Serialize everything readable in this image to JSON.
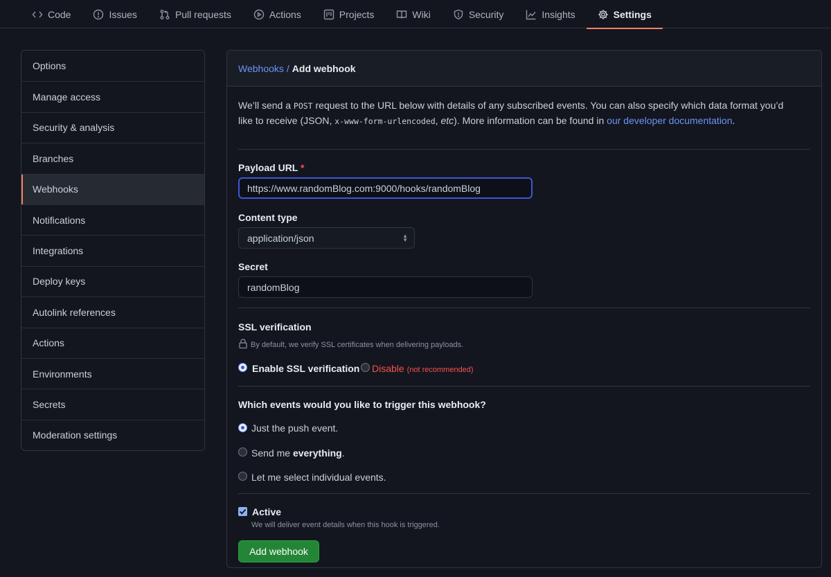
{
  "nav": {
    "tabs": [
      {
        "label": "Code",
        "icon": "code-icon"
      },
      {
        "label": "Issues",
        "icon": "issue-icon"
      },
      {
        "label": "Pull requests",
        "icon": "pull-request-icon"
      },
      {
        "label": "Actions",
        "icon": "play-icon"
      },
      {
        "label": "Projects",
        "icon": "project-icon"
      },
      {
        "label": "Wiki",
        "icon": "book-icon"
      },
      {
        "label": "Security",
        "icon": "shield-icon"
      },
      {
        "label": "Insights",
        "icon": "graph-icon"
      },
      {
        "label": "Settings",
        "icon": "gear-icon"
      }
    ],
    "active_tab": "Settings"
  },
  "sidebar": {
    "items": [
      {
        "label": "Options"
      },
      {
        "label": "Manage access"
      },
      {
        "label": "Security & analysis"
      },
      {
        "label": "Branches"
      },
      {
        "label": "Webhooks"
      },
      {
        "label": "Notifications"
      },
      {
        "label": "Integrations"
      },
      {
        "label": "Deploy keys"
      },
      {
        "label": "Autolink references"
      },
      {
        "label": "Actions"
      },
      {
        "label": "Environments"
      },
      {
        "label": "Secrets"
      },
      {
        "label": "Moderation settings"
      }
    ],
    "active": "Webhooks"
  },
  "breadcrumb": {
    "parent": "Webhooks",
    "separator": "/",
    "current": "Add webhook"
  },
  "intro": {
    "part1": "We’ll send a ",
    "code1": "POST",
    "part2": " request to the URL below with details of any subscribed events. You can also specify which data format you’d like to receive (JSON, ",
    "code2": "x-www-form-urlencoded",
    "part3": ", ",
    "etc": "etc",
    "part4": "). More information can be found in ",
    "link": "our developer documentation",
    "part5": "."
  },
  "form": {
    "payload_url": {
      "label": "Payload URL",
      "required_mark": "*",
      "value": "https://www.randomBlog.com:9000/hooks/randomBlog"
    },
    "content_type": {
      "label": "Content type",
      "value": "application/json"
    },
    "secret": {
      "label": "Secret",
      "value": "randomBlog"
    },
    "ssl": {
      "label": "SSL verification",
      "note": "By default, we verify SSL certificates when delivering payloads.",
      "enable_label": "Enable SSL verification",
      "disable_label": "Disable",
      "disable_note": "(not recommended)",
      "selected": "enable"
    },
    "events": {
      "question": "Which events would you like to trigger this webhook?",
      "options": [
        {
          "prefix": "Just the push event.",
          "bold": "",
          "suffix": ""
        },
        {
          "prefix": "Send me ",
          "bold": "everything",
          "suffix": "."
        },
        {
          "prefix": "Let me select individual events.",
          "bold": "",
          "suffix": ""
        }
      ],
      "selected_index": 0
    },
    "active": {
      "label": "Active",
      "checked": true,
      "note": "We will deliver event details when this hook is triggered."
    },
    "submit_label": "Add webhook"
  },
  "colors": {
    "accent_tab": "#f78166",
    "link": "#6c94f5",
    "button": "#238636",
    "danger": "#f85149"
  }
}
